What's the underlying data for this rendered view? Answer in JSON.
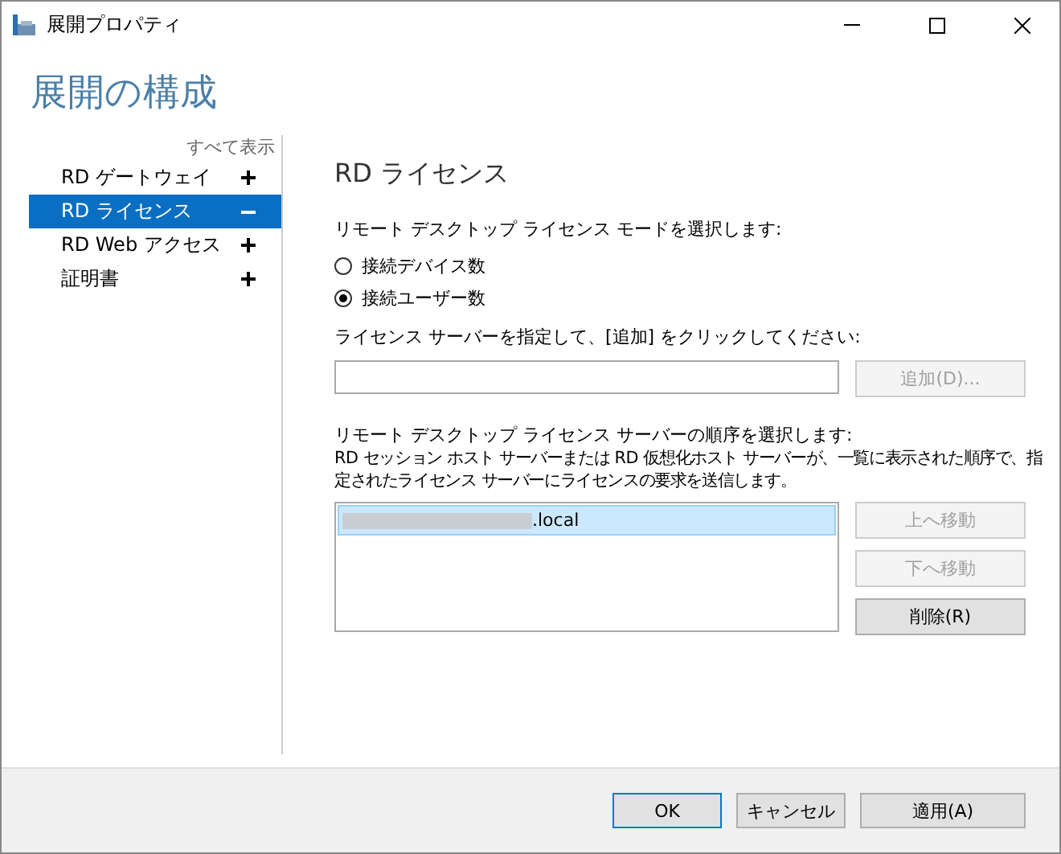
{
  "window": {
    "title": "展開プロパティ"
  },
  "heading": "展開の構成",
  "sidebar": {
    "show_all": "すべて表示",
    "items": [
      {
        "label": "RD ゲートウェイ",
        "selected": false,
        "expanded": false
      },
      {
        "label": "RD ライセンス",
        "selected": true,
        "expanded": true
      },
      {
        "label": "RD Web アクセス",
        "selected": false,
        "expanded": false
      },
      {
        "label": "証明書",
        "selected": false,
        "expanded": false
      }
    ]
  },
  "content": {
    "title": "RD ライセンス",
    "mode_label": "リモート デスクトップ ライセンス モードを選択します:",
    "modes": [
      {
        "label": "接続デバイス数",
        "selected": false
      },
      {
        "label": "接続ユーザー数",
        "selected": true
      }
    ],
    "server_label": "ライセンス サーバーを指定して、[追加] をクリックしてください:",
    "add_button": {
      "label": "追加(D)...",
      "disabled": true
    },
    "order_label": "リモート デスクトップ ライセンス サーバーの順序を選択します:",
    "order_description": "RD セッション ホスト サーバーまたは RD 仮想化ホスト サーバーが、一覧に表示された順序で、指定されたライセンス サーバーにライセンスの要求を送信します。",
    "servers": [
      {
        "label": ".local",
        "selected": true,
        "redacted": true
      }
    ],
    "list_buttons": [
      {
        "label": "上へ移動",
        "disabled": true
      },
      {
        "label": "下へ移動",
        "disabled": true
      },
      {
        "label": "削除(R)",
        "disabled": false
      }
    ]
  },
  "footer_buttons": [
    {
      "label": "OK",
      "default": true
    },
    {
      "label": "キャンセル",
      "default": false
    },
    {
      "label": "適用(A)",
      "default": false
    }
  ]
}
